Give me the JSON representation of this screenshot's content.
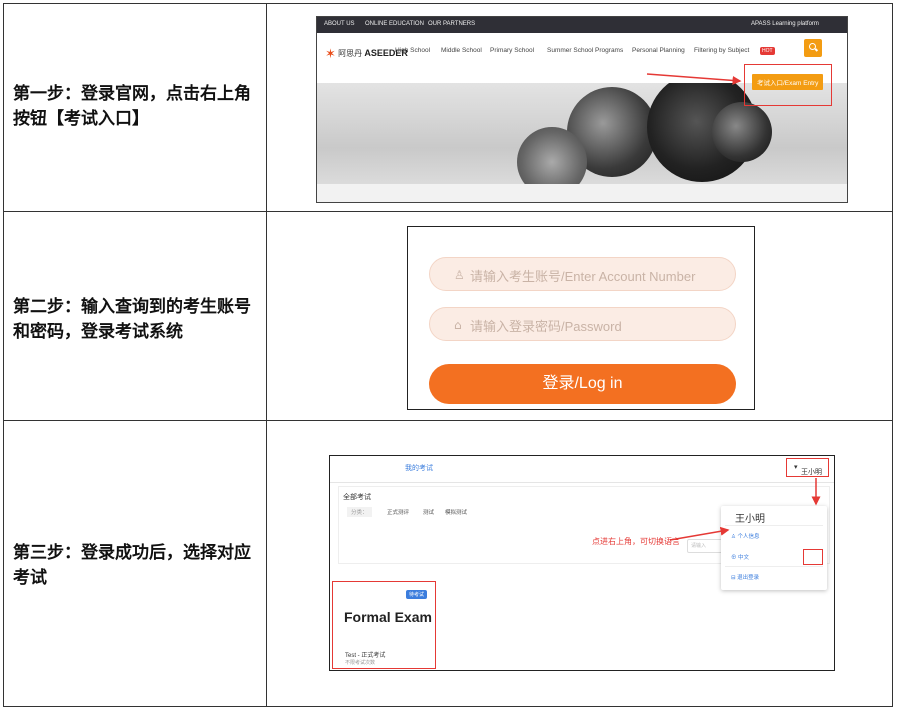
{
  "steps": [
    {
      "text": "第一步：登录官网，点击右上角按钮【考试入口】",
      "site": {
        "topbar": [
          "ABOUT US",
          "ONLINE EDUCATION",
          "OUR PARTNERS",
          "APASS Learning platform"
        ],
        "logo_cn": "阿思丹",
        "logo_brand": "ASEEDER",
        "menu": [
          "High School",
          "Middle School",
          "Primary School",
          "Summer School Programs",
          "Personal Planning",
          "Filtering by Subject"
        ],
        "hot_badge": "HOT",
        "search_icon": "search-icon",
        "exam_entry": "考试入口/Exam Entry",
        "accent_color": "#f39c12"
      }
    },
    {
      "text": "第二步：输入查询到的考生账号和密码，登录考试系统",
      "login": {
        "account_placeholder": "请输入考生账号/Enter Account Number",
        "password_placeholder": "请输入登录密码/Password",
        "login_button": "登录/Log in",
        "button_color": "#f37021",
        "user_icon": "user-icon",
        "lock_icon": "lock-icon"
      }
    },
    {
      "text": "第三步：登录成功后，选择对应考试",
      "exam": {
        "tab": "我的考试",
        "user": "王小明",
        "all_exams": "全部考试",
        "category_label": "分类：",
        "categories": [
          "正式测评",
          "测试",
          "模拟测试"
        ],
        "search_placeholder": "请输入",
        "hint": "点进右上角，可切换语言",
        "dropdown": {
          "name": "王小明",
          "items": [
            "个人信息",
            "中文",
            "退出登录"
          ]
        },
        "card": {
          "badge": "待考试",
          "title": "Formal Exam",
          "subtitle": "Test - 正式考试",
          "note": "不限考试次数"
        }
      }
    }
  ]
}
